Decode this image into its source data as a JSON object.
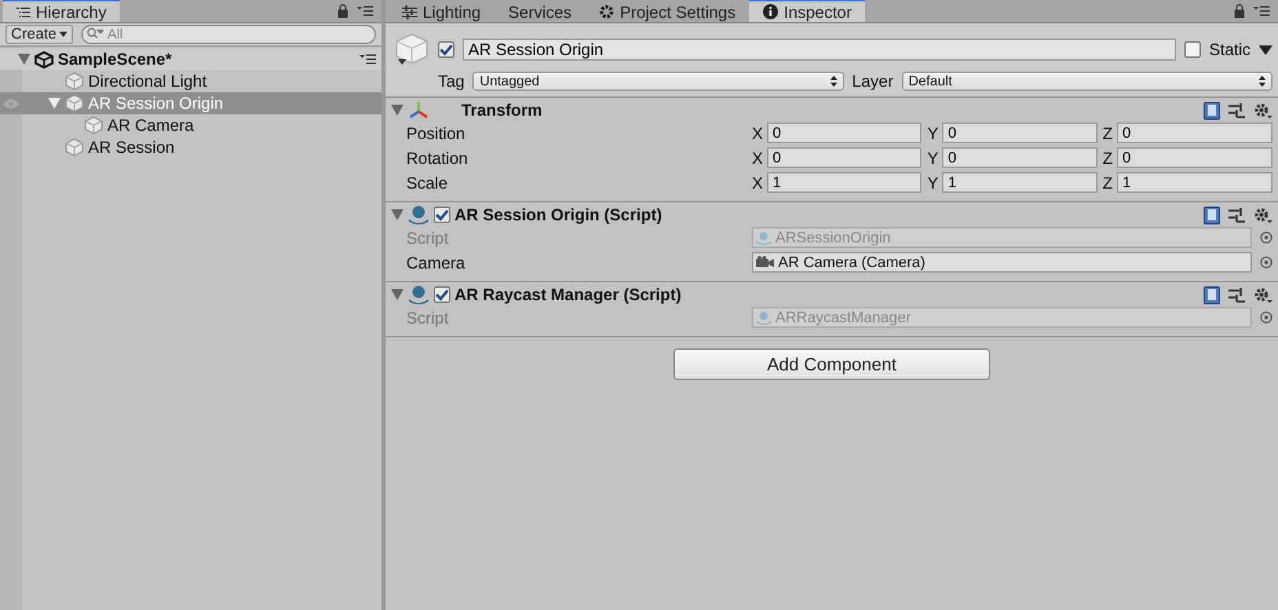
{
  "hierarchy": {
    "tab": "Hierarchy",
    "create_button": "Create",
    "search": {
      "placeholder": "All"
    },
    "scene": {
      "name": "SampleScene*",
      "expanded": true,
      "children": [
        {
          "name": "Directional Light",
          "selected": false
        },
        {
          "name": "AR Session Origin",
          "selected": true,
          "expanded": true,
          "children": [
            {
              "name": "AR Camera",
              "selected": false
            }
          ]
        },
        {
          "name": "AR Session",
          "selected": false
        }
      ]
    }
  },
  "tabs": [
    {
      "label": "Lighting",
      "kind": "lighting",
      "selected": false
    },
    {
      "label": "Services",
      "kind": "services",
      "selected": false
    },
    {
      "label": "Project Settings",
      "kind": "settings",
      "selected": false
    },
    {
      "label": "Inspector",
      "kind": "inspector",
      "selected": true
    }
  ],
  "inspector": {
    "object": {
      "active": true,
      "name": "AR Session Origin",
      "static": false,
      "static_label": "Static",
      "tag_label": "Tag",
      "tag": "Untagged",
      "layer_label": "Layer",
      "layer": "Default"
    },
    "components": [
      {
        "kind": "transform",
        "title": "Transform",
        "expanded": true,
        "rows": [
          {
            "label": "Position",
            "values": [
              {
                "axis": "X",
                "value": "0"
              },
              {
                "axis": "Y",
                "value": "0"
              },
              {
                "axis": "Z",
                "value": "0"
              }
            ]
          },
          {
            "label": "Rotation",
            "values": [
              {
                "axis": "X",
                "value": "0"
              },
              {
                "axis": "Y",
                "value": "0"
              },
              {
                "axis": "Z",
                "value": "0"
              }
            ]
          },
          {
            "label": "Scale",
            "values": [
              {
                "axis": "X",
                "value": "1"
              },
              {
                "axis": "Y",
                "value": "1"
              },
              {
                "axis": "Z",
                "value": "1"
              }
            ]
          }
        ]
      },
      {
        "kind": "script",
        "title": "AR Session Origin (Script)",
        "enabled": true,
        "expanded": true,
        "fields": [
          {
            "label": "Script",
            "value": "ARSessionOrigin",
            "kind": "script",
            "disabled": true
          },
          {
            "label": "Camera",
            "value": "AR Camera (Camera)",
            "kind": "camera",
            "disabled": false
          }
        ]
      },
      {
        "kind": "script",
        "title": "AR Raycast Manager (Script)",
        "enabled": true,
        "expanded": true,
        "fields": [
          {
            "label": "Script",
            "value": "ARRaycastManager",
            "kind": "script",
            "disabled": true
          }
        ]
      }
    ],
    "add_button": "Add Component"
  }
}
